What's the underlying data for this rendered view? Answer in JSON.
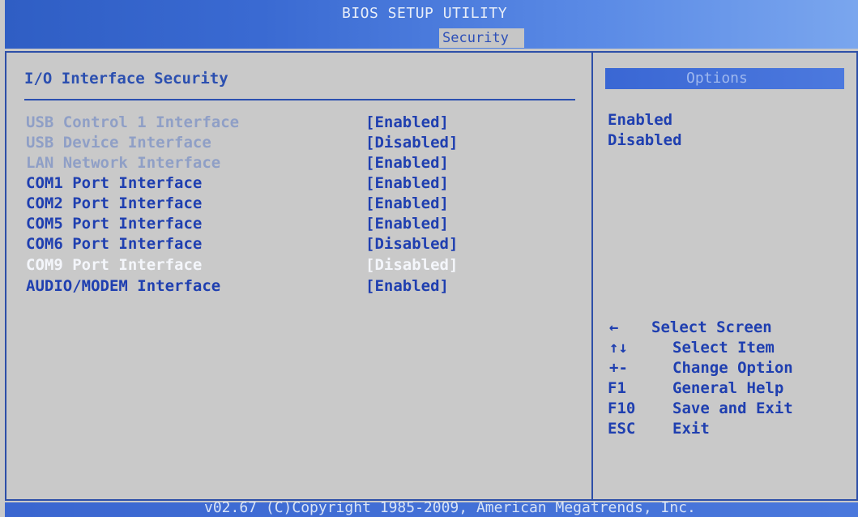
{
  "header": {
    "title": "BIOS SETUP UTILITY",
    "active_tab": "Security"
  },
  "main": {
    "section_title": "I/O Interface Security",
    "items": [
      {
        "label": "USB Control 1 Interface",
        "value": "[Enabled]",
        "state": "dim"
      },
      {
        "label": "USB Device Interface",
        "value": "[Disabled]",
        "state": "dim"
      },
      {
        "label": "LAN Network Interface",
        "value": "[Enabled]",
        "state": "dim"
      },
      {
        "label": "COM1 Port Interface",
        "value": "[Enabled]",
        "state": "normal"
      },
      {
        "label": "COM2 Port Interface",
        "value": "[Enabled]",
        "state": "normal"
      },
      {
        "label": "COM5 Port Interface",
        "value": "[Enabled]",
        "state": "normal"
      },
      {
        "label": "COM6 Port Interface",
        "value": "[Disabled]",
        "state": "normal"
      },
      {
        "label": "COM9 Port Interface",
        "value": "[Disabled]",
        "state": "selected"
      },
      {
        "label": "AUDIO/MODEM Interface",
        "value": "[Enabled]",
        "state": "normal"
      }
    ]
  },
  "options_panel": {
    "title": "Options",
    "options": [
      "Enabled",
      "Disabled"
    ]
  },
  "help": [
    {
      "key": "←",
      "text": "Select Screen"
    },
    {
      "key": "↑↓",
      "text": "Select Item"
    },
    {
      "key": "+-",
      "text": "Change Option"
    },
    {
      "key": "F1",
      "text": "General Help"
    },
    {
      "key": "F10",
      "text": "Save and Exit"
    },
    {
      "key": "ESC",
      "text": "Exit"
    }
  ],
  "footer": {
    "text": "v02.67 (C)Copyright 1985-2009, American Megatrends, Inc."
  },
  "colors": {
    "title_bar": "#3a6ad2",
    "background": "#c9c9c9",
    "text_blue": "#1f3fb0",
    "text_dim": "#8f9fc6",
    "selected_text": "#f4f6fb"
  }
}
